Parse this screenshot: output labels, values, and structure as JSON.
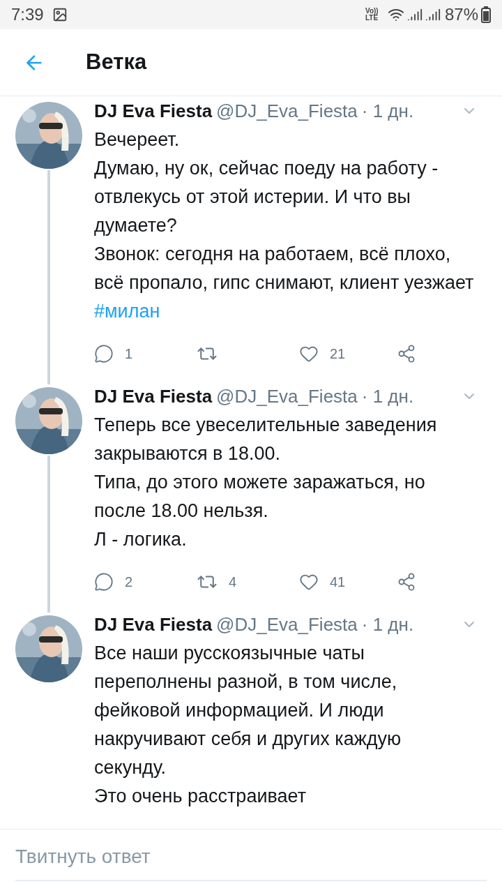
{
  "status_bar": {
    "time": "7:39",
    "volte": "Vo)) LTE",
    "battery": "87%"
  },
  "header": {
    "title": "Ветка"
  },
  "tweets": [
    {
      "name": "DJ Eva Fiesta",
      "handle": "@DJ_Eva_Fiesta",
      "time": "· 1 дн.",
      "thread_line": true,
      "body": [
        {
          "kind": "text",
          "text": "Вечереет."
        },
        {
          "kind": "text",
          "text": "Думаю, ну ок, сейчас поеду на работу - отвлекусь от этой истерии. И что вы думаете?"
        },
        {
          "kind": "text",
          "text": "Звонок: сегодня на работаем, всё плохо, всё пропало, гипс снимают, клиент уезжает"
        },
        {
          "kind": "hashtag",
          "text": "#милан"
        }
      ],
      "actions": {
        "replies": "1",
        "likes": "21"
      }
    },
    {
      "name": "DJ Eva Fiesta",
      "handle": "@DJ_Eva_Fiesta",
      "time": "· 1 дн.",
      "thread_line": true,
      "body": [
        {
          "kind": "text",
          "text": "Теперь все увеселительные заведения закрываются в 18.00."
        },
        {
          "kind": "text",
          "text": "Типа, до этого можете заражаться, но после 18.00 нельзя."
        },
        {
          "kind": "text",
          "text": "Л - логика."
        }
      ],
      "actions": {
        "replies": "2",
        "retweets": "4",
        "likes": "41"
      }
    },
    {
      "name": "DJ Eva Fiesta",
      "handle": "@DJ_Eva_Fiesta",
      "time": "· 1 дн.",
      "thread_line": false,
      "body": [
        {
          "kind": "text",
          "text": "Все наши русскоязычные чаты переполнены разной, в том числе, фейковой информацией. И люди накручивают себя и других каждую секунду."
        },
        {
          "kind": "text",
          "text": "Это очень расстраивает"
        }
      ]
    }
  ],
  "reply_bar": {
    "placeholder": "Твитнуть ответ"
  }
}
